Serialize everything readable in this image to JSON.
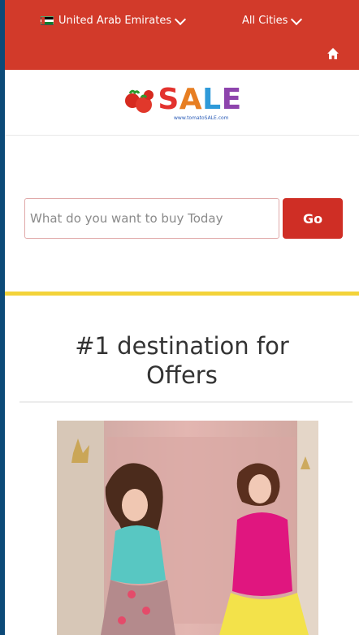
{
  "header": {
    "country_label": "United Arab Emirates",
    "city_label": "All Cities",
    "home_icon": "home-icon",
    "bar_color": "#d23a2a"
  },
  "logo": {
    "letters": [
      "S",
      "A",
      "L",
      "E"
    ],
    "subtext": "www.tomatoSALE.com"
  },
  "search": {
    "placeholder": "What do you want to buy Today",
    "value": "",
    "go_label": "Go"
  },
  "headline": {
    "text": "#1 destination for Offers"
  },
  "colors": {
    "accent_red": "#cf2e25",
    "yellow_line": "#f3d33a",
    "outer_border": "#0c4a78"
  }
}
